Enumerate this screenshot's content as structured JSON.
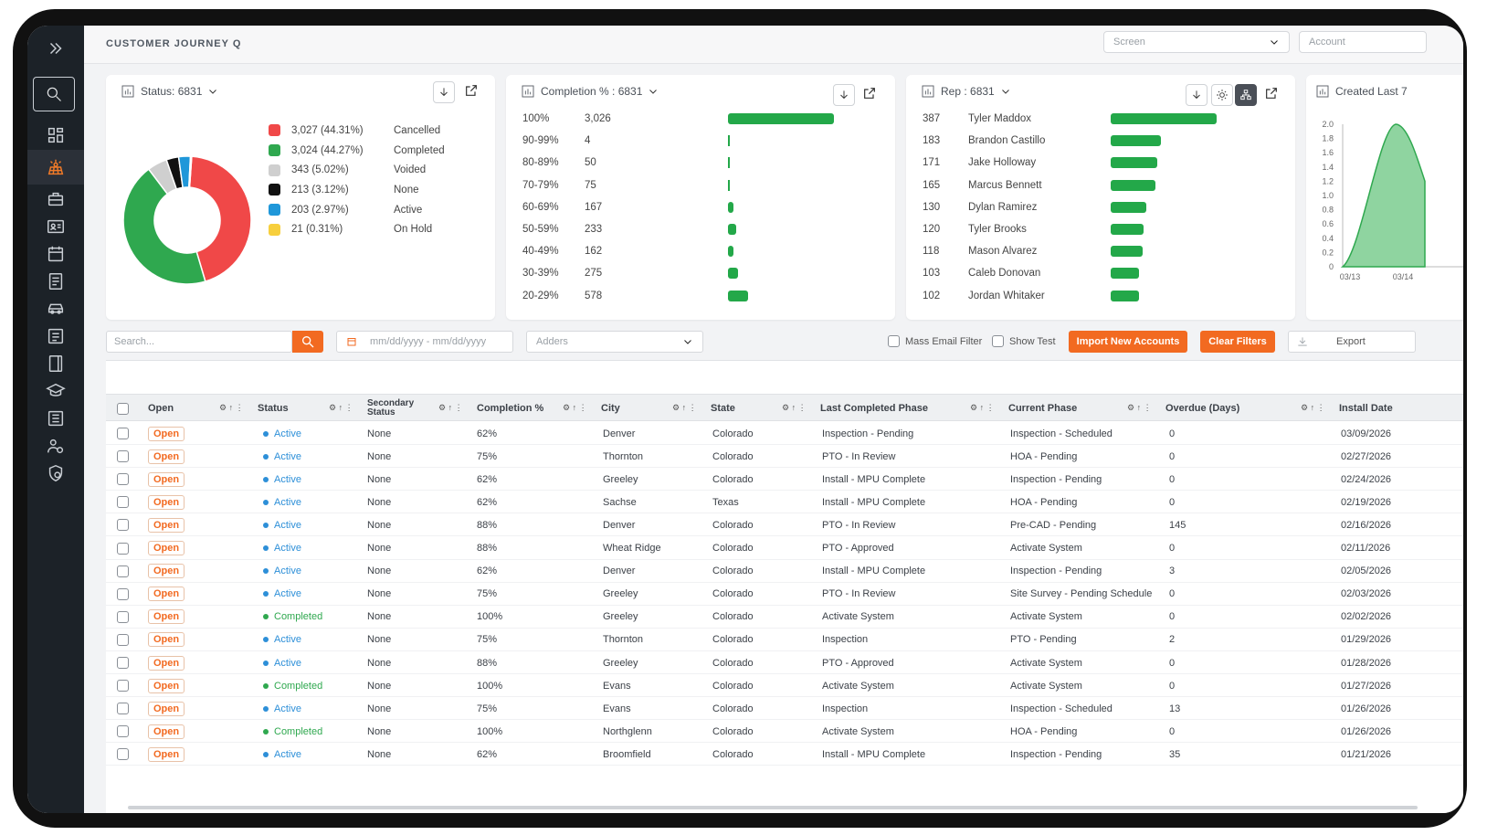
{
  "app": {
    "title": "CUSTOMER JOURNEY Q"
  },
  "topbar": {
    "screen_placeholder": "Screen",
    "account_placeholder": "Account"
  },
  "status_card": {
    "title": "Status: 6831",
    "legend": [
      {
        "value": "3,027 (44.31%)",
        "label": "Cancelled",
        "color": "#f04848",
        "fraction": 0.4431
      },
      {
        "value": "3,024 (44.27%)",
        "label": "Completed",
        "color": "#2fa84f",
        "fraction": 0.4427
      },
      {
        "value": "343 (5.02%)",
        "label": "Voided",
        "color": "#cfcfcf",
        "fraction": 0.0502
      },
      {
        "value": "213 (3.12%)",
        "label": "None",
        "color": "#111111",
        "fraction": 0.0312
      },
      {
        "value": "203 (2.97%)",
        "label": "Active",
        "color": "#1f97d9",
        "fraction": 0.0297
      },
      {
        "value": "21 (0.31%)",
        "label": "On Hold",
        "color": "#f7cf3d",
        "fraction": 0.0031
      }
    ]
  },
  "completion_card": {
    "title": "Completion % : 6831",
    "rows": [
      {
        "range": "100%",
        "count": "3,026",
        "value": 3026
      },
      {
        "range": "90-99%",
        "count": "4",
        "value": 4
      },
      {
        "range": "80-89%",
        "count": "50",
        "value": 50
      },
      {
        "range": "70-79%",
        "count": "75",
        "value": 75
      },
      {
        "range": "60-69%",
        "count": "167",
        "value": 167
      },
      {
        "range": "50-59%",
        "count": "233",
        "value": 233
      },
      {
        "range": "40-49%",
        "count": "162",
        "value": 162
      },
      {
        "range": "30-39%",
        "count": "275",
        "value": 275
      },
      {
        "range": "20-29%",
        "count": "578",
        "value": 578
      }
    ]
  },
  "rep_card": {
    "title": "Rep : 6831",
    "rows": [
      {
        "count": "387",
        "name": "Tyler Maddox",
        "value": 387
      },
      {
        "count": "183",
        "name": "Brandon Castillo",
        "value": 183
      },
      {
        "count": "171",
        "name": "Jake Holloway",
        "value": 171
      },
      {
        "count": "165",
        "name": "Marcus Bennett",
        "value": 165
      },
      {
        "count": "130",
        "name": "Dylan Ramirez",
        "value": 130
      },
      {
        "count": "120",
        "name": "Tyler Brooks",
        "value": 120
      },
      {
        "count": "118",
        "name": "Mason Alvarez",
        "value": 118
      },
      {
        "count": "103",
        "name": "Caleb Donovan",
        "value": 103
      },
      {
        "count": "102",
        "name": "Jordan Whitaker",
        "value": 102
      }
    ]
  },
  "created_card": {
    "title": "Created Last 7",
    "chart_data": {
      "type": "area",
      "y_ticks": [
        "2.0",
        "1.8",
        "1.6",
        "1.4",
        "1.2",
        "1.0",
        "0.8",
        "0.6",
        "0.4",
        "0.2",
        "0"
      ],
      "x_ticks": [
        "03/13",
        "03/14"
      ],
      "ylim": [
        0,
        2.0
      ],
      "color": "#2fa84f"
    }
  },
  "toolbar": {
    "search_placeholder": "Search...",
    "date_placeholder": "mm/dd/yyyy - mm/dd/yyyy",
    "adders_placeholder": "Adders",
    "mass_email_label": "Mass Email Filter",
    "show_test_label": "Show Test",
    "import_label": "Import New Accounts",
    "clear_label": "Clear Filters",
    "export_label": "Export"
  },
  "table": {
    "headers": {
      "open": "Open",
      "status": "Status",
      "secondary_status": "Secondary Status",
      "completion": "Completion %",
      "city": "City",
      "state": "State",
      "last_phase": "Last Completed Phase",
      "current_phase": "Current Phase",
      "overdue": "Overdue (Days)",
      "install_date": "Install Date"
    },
    "rows": [
      {
        "open": "Open",
        "status": "Active",
        "secondary": "None",
        "completion": "62%",
        "city": "Denver",
        "state": "Colorado",
        "last": "Inspection - Pending",
        "current": "Inspection - Scheduled",
        "overdue": "0",
        "install": "03/09/2026"
      },
      {
        "open": "Open",
        "status": "Active",
        "secondary": "None",
        "completion": "75%",
        "city": "Thornton",
        "state": "Colorado",
        "last": "PTO - In Review",
        "current": "HOA - Pending",
        "overdue": "0",
        "install": "02/27/2026"
      },
      {
        "open": "Open",
        "status": "Active",
        "secondary": "None",
        "completion": "62%",
        "city": "Greeley",
        "state": "Colorado",
        "last": "Install - MPU Complete",
        "current": "Inspection - Pending",
        "overdue": "0",
        "install": "02/24/2026"
      },
      {
        "open": "Open",
        "status": "Active",
        "secondary": "None",
        "completion": "62%",
        "city": "Sachse",
        "state": "Texas",
        "last": "Install - MPU Complete",
        "current": "HOA - Pending",
        "overdue": "0",
        "install": "02/19/2026"
      },
      {
        "open": "Open",
        "status": "Active",
        "secondary": "None",
        "completion": "88%",
        "city": "Denver",
        "state": "Colorado",
        "last": "PTO - In Review",
        "current": "Pre-CAD - Pending",
        "overdue": "145",
        "install": "02/16/2026"
      },
      {
        "open": "Open",
        "status": "Active",
        "secondary": "None",
        "completion": "88%",
        "city": "Wheat Ridge",
        "state": "Colorado",
        "last": "PTO - Approved",
        "current": "Activate System",
        "overdue": "0",
        "install": "02/11/2026"
      },
      {
        "open": "Open",
        "status": "Active",
        "secondary": "None",
        "completion": "62%",
        "city": "Denver",
        "state": "Colorado",
        "last": "Install - MPU Complete",
        "current": "Inspection - Pending",
        "overdue": "3",
        "install": "02/05/2026"
      },
      {
        "open": "Open",
        "status": "Active",
        "secondary": "None",
        "completion": "75%",
        "city": "Greeley",
        "state": "Colorado",
        "last": "PTO - In Review",
        "current": "Site Survey - Pending Schedule",
        "overdue": "0",
        "install": "02/03/2026"
      },
      {
        "open": "Open",
        "status": "Completed",
        "secondary": "None",
        "completion": "100%",
        "city": "Greeley",
        "state": "Colorado",
        "last": "Activate System",
        "current": "Activate System",
        "overdue": "0",
        "install": "02/02/2026"
      },
      {
        "open": "Open",
        "status": "Active",
        "secondary": "None",
        "completion": "75%",
        "city": "Thornton",
        "state": "Colorado",
        "last": "Inspection",
        "current": "PTO - Pending",
        "overdue": "2",
        "install": "01/29/2026"
      },
      {
        "open": "Open",
        "status": "Active",
        "secondary": "None",
        "completion": "88%",
        "city": "Greeley",
        "state": "Colorado",
        "last": "PTO - Approved",
        "current": "Activate System",
        "overdue": "0",
        "install": "01/28/2026"
      },
      {
        "open": "Open",
        "status": "Completed",
        "secondary": "None",
        "completion": "100%",
        "city": "Evans",
        "state": "Colorado",
        "last": "Activate System",
        "current": "Activate System",
        "overdue": "0",
        "install": "01/27/2026"
      },
      {
        "open": "Open",
        "status": "Active",
        "secondary": "None",
        "completion": "75%",
        "city": "Evans",
        "state": "Colorado",
        "last": "Inspection",
        "current": "Inspection - Scheduled",
        "overdue": "13",
        "install": "01/26/2026"
      },
      {
        "open": "Open",
        "status": "Completed",
        "secondary": "None",
        "completion": "100%",
        "city": "Northglenn",
        "state": "Colorado",
        "last": "Activate System",
        "current": "HOA - Pending",
        "overdue": "0",
        "install": "01/26/2026"
      },
      {
        "open": "Open",
        "status": "Active",
        "secondary": "None",
        "completion": "62%",
        "city": "Broomfield",
        "state": "Colorado",
        "last": "Install - MPU Complete",
        "current": "Inspection - Pending",
        "overdue": "35",
        "install": "01/21/2026"
      }
    ]
  },
  "colors": {
    "accent": "#f26a21",
    "bar": "#23a849",
    "active": "#2d8fd8",
    "completed": "#2fa84f"
  }
}
